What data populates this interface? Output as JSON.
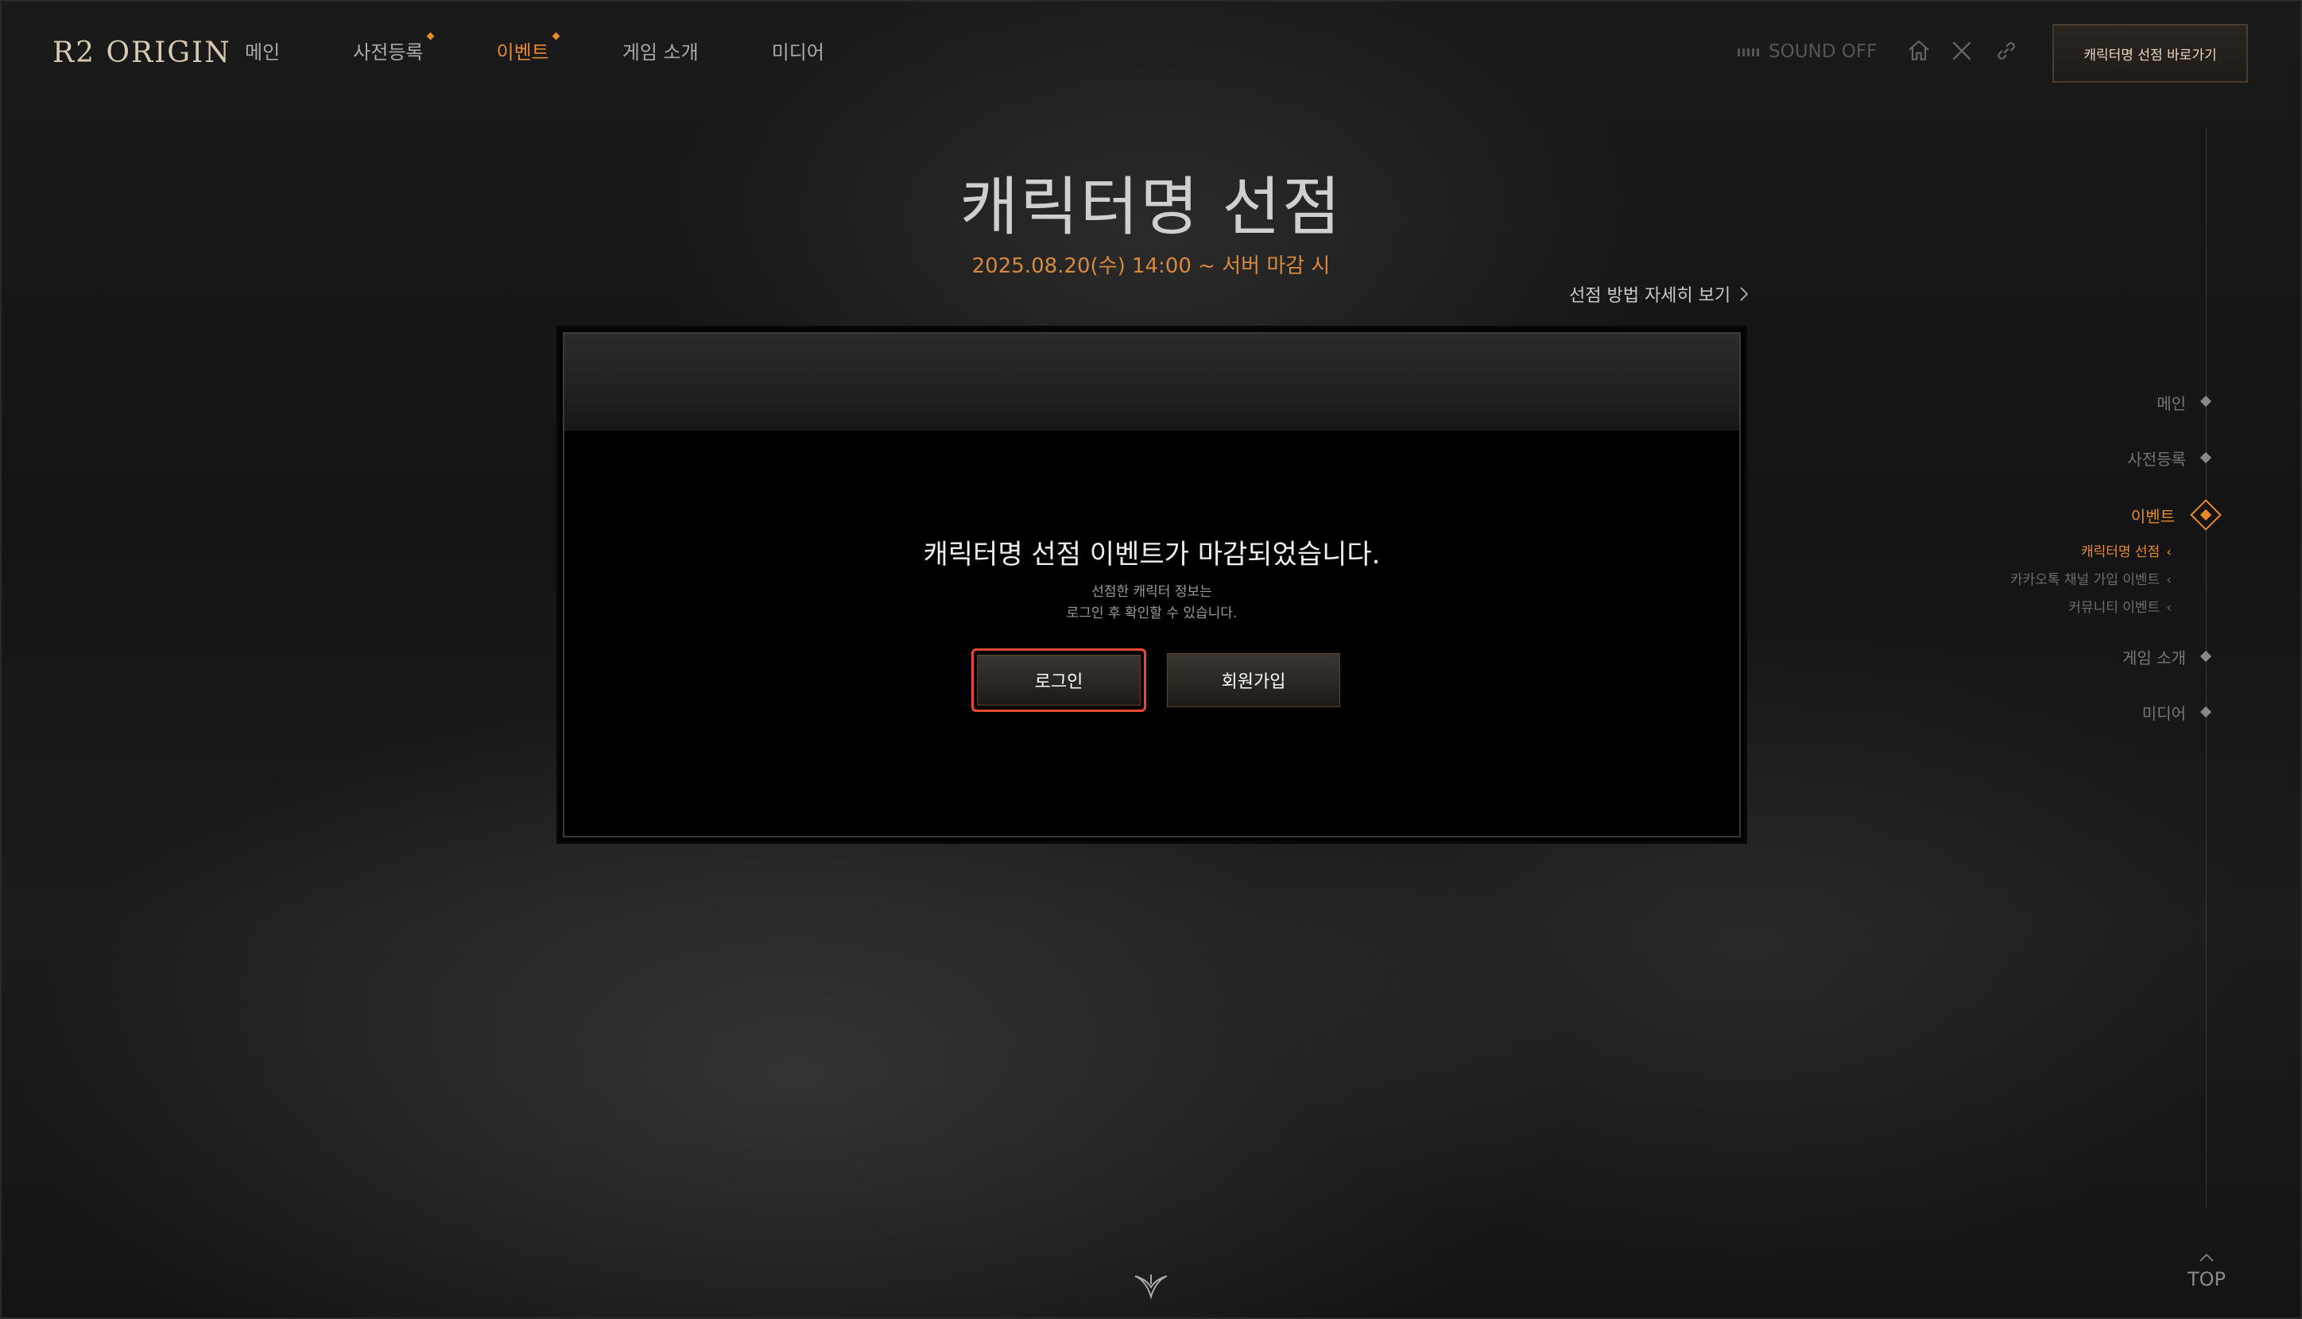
{
  "header": {
    "logo": "R2 ORIGIN",
    "nav": [
      {
        "label": "메인",
        "active": false,
        "dot": false
      },
      {
        "label": "사전등록",
        "active": false,
        "dot": true
      },
      {
        "label": "이벤트",
        "active": true,
        "dot": true
      },
      {
        "label": "게임 소개",
        "active": false,
        "dot": false
      },
      {
        "label": "미디어",
        "active": false,
        "dot": false
      }
    ],
    "sound_label": "SOUND OFF",
    "cta_label": "캐릭터명 선점 바로가기",
    "icons": [
      "home-icon",
      "x-twitter-icon",
      "link-icon"
    ]
  },
  "main": {
    "title": "캐릭터명 선점",
    "period": "2025.08.20(수) 14:00 ~ 서버 마감 시",
    "guide_link": "선점 방법 자세히 보기",
    "panel": {
      "message": "캐릭터명 선점 이벤트가 마감되었습니다.",
      "sub_line1": "선점한 캐릭터 정보는",
      "sub_line2": "로그인 후 확인할 수 있습니다.",
      "login_label": "로그인",
      "join_label": "회원가입"
    }
  },
  "side_nav": {
    "items": [
      "메인",
      "사전등록",
      "이벤트",
      "게임 소개",
      "미디어"
    ],
    "sub_items": [
      "캐릭터명 선점",
      "카카오톡 채널 가입 이벤트",
      "커뮤니티 이벤트"
    ],
    "active_item": "이벤트",
    "active_sub": "캐릭터명 선점"
  },
  "top_label": "TOP",
  "colors": {
    "accent": "#e58b2e",
    "highlight_border": "#e54b33"
  }
}
